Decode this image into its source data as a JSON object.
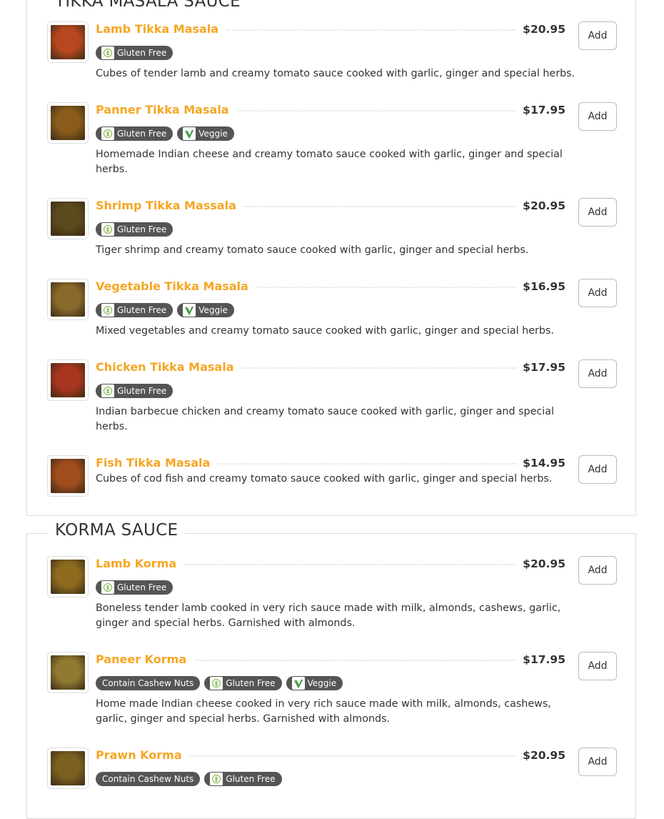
{
  "sections": [
    {
      "title": "TIKKA MASALA SAUCE",
      "items": [
        {
          "name": "Lamb Tikka Masala",
          "price": "$20.95",
          "tags": [
            "Gluten Free"
          ],
          "description": "Cubes of tender lamb and creamy tomato sauce cooked with garlic, ginger and special herbs."
        },
        {
          "name": "Panner Tikka Masala",
          "price": "$17.95",
          "tags": [
            "Gluten Free",
            "Veggie"
          ],
          "description": "Homemade Indian cheese and creamy tomato sauce cooked with garlic, ginger and special herbs."
        },
        {
          "name": "Shrimp Tikka Massala",
          "price": "$20.95",
          "tags": [
            "Gluten Free"
          ],
          "description": "Tiger shrimp and creamy tomato sauce cooked with garlic, ginger and special herbs."
        },
        {
          "name": "Vegetable Tikka Masala",
          "price": "$16.95",
          "tags": [
            "Gluten Free",
            "Veggie"
          ],
          "description": "Mixed vegetables and creamy tomato sauce cooked with garlic, ginger and special herbs."
        },
        {
          "name": "Chicken Tikka Masala",
          "price": "$17.95",
          "tags": [
            "Gluten Free"
          ],
          "description": "Indian barbecue chicken and creamy tomato sauce cooked with garlic, ginger and special herbs."
        },
        {
          "name": "Fish Tikka Masala",
          "price": "$14.95",
          "tags": [],
          "description": "Cubes of cod fish and creamy tomato sauce cooked with garlic, ginger and special herbs."
        }
      ]
    },
    {
      "title": "KORMA SAUCE",
      "items": [
        {
          "name": "Lamb Korma",
          "price": "$20.95",
          "tags": [
            "Gluten Free"
          ],
          "description": "Boneless tender lamb cooked in very rich sauce made with milk, almonds, cashews, garlic, ginger and special herbs. Garnished with almonds."
        },
        {
          "name": "Paneer Korma",
          "price": "$17.95",
          "tags": [
            "Contain Cashew Nuts",
            "Gluten Free",
            "Veggie"
          ],
          "description": "Home made Indian cheese cooked in very rich sauce made with milk, almonds, cashews, garlic, ginger and special herbs. Garnished with almonds."
        },
        {
          "name": "Prawn Korma",
          "price": "$20.95",
          "tags": [
            "Contain Cashew Nuts",
            "Gluten Free"
          ],
          "description": ""
        }
      ]
    }
  ],
  "add_label": "Add",
  "tag_icons": {
    "Gluten Free": "gluten-free-icon",
    "Veggie": "veggie-icon",
    "Contain Cashew Nuts": ""
  },
  "colors": {
    "item_name": "#f5a623",
    "tag_bg": "#555555",
    "gluten_icon": "#7cb342",
    "veggie_icon": "#43a047"
  }
}
